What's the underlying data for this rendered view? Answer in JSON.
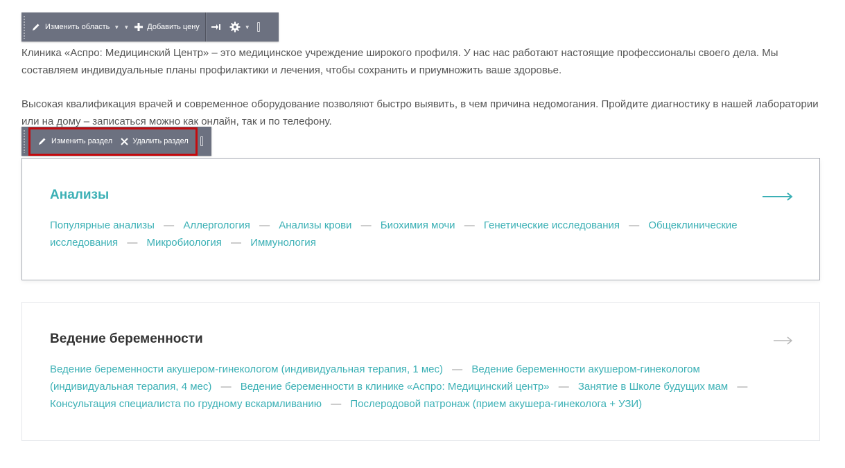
{
  "toolbar_top": {
    "edit_area_label": "Изменить область",
    "add_price_label": "Добавить цену"
  },
  "toolbar_section": {
    "edit_section_label": "Изменить раздел",
    "delete_section_label": "Удалить раздел"
  },
  "intro": {
    "paragraph_1": "Клиника «Аспро: Медицинский Центр» – это медицинское учреждение широкого профиля. У нас нас работают настоящие профессионалы своего дела. Мы составляем индивидуальные планы профилактики и лечения, чтобы сохранить и приумножить ваше здоровье.",
    "paragraph_2": "Высокая квалификация врачей и современное оборудование позволяют быстро выявить, в чем причина недомогания. Пройдите диагностику в нашей лаборатории или на дому – записаться можно как онлайн, так и по телефону."
  },
  "sections": [
    {
      "title": "Анализы",
      "links": [
        "Популярные анализы",
        "Аллергология",
        "Анализы крови",
        "Биохимия мочи",
        "Генетические исследования",
        "Общеклинические исследования",
        "Микробиология",
        "Иммунология"
      ]
    },
    {
      "title": "Ведение беременности",
      "links": [
        "Ведение беременности акушером-гинекологом (индивидуальная терапия, 1 мес)",
        "Ведение беременности акушером-гинекологом (индивидуальная терапия, 4 мес)",
        "Ведение беременности в клинике «Аспро: Медицинский центр»",
        "Занятие в Школе будущих мам",
        "Консультация специалиста по грудному вскармливанию",
        "Послеродовой патронаж (прием акушера-гинеколога + УЗИ)"
      ]
    }
  ],
  "separator": "—",
  "colors": {
    "accent": "#3bb0b5",
    "toolbar_bg": "#6c7180",
    "highlight_border": "#c30a0e",
    "body_text": "#555555"
  }
}
